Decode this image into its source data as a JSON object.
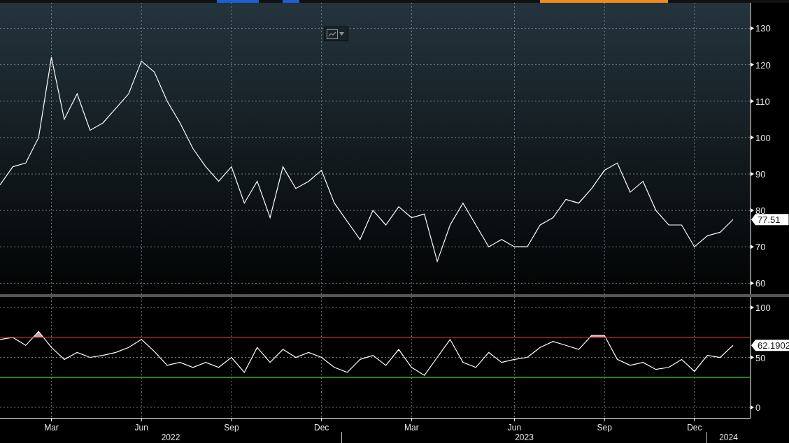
{
  "toolbar_edges": [
    {
      "color": "#1d5fd0"
    },
    {
      "color": "#1d5fd0"
    },
    {
      "color": "#f08a1c"
    }
  ],
  "chart_type_button": {
    "kind": "line"
  },
  "price_panel": {
    "chart_data": {
      "type": "line",
      "grid": true,
      "ylim": [
        57,
        137
      ],
      "yticks": [
        60,
        70,
        80,
        90,
        100,
        110,
        120,
        130
      ],
      "categories": [
        null,
        null,
        null,
        null,
        null,
        null,
        null,
        null,
        null,
        null,
        null,
        null,
        null,
        null,
        null,
        null,
        null,
        null,
        null,
        null,
        null,
        null,
        null,
        null,
        null,
        null,
        null,
        null,
        null,
        null,
        null,
        null,
        null,
        null,
        null,
        null,
        null,
        null,
        null,
        null,
        null,
        null,
        null,
        null,
        null,
        null,
        null,
        null,
        null,
        null,
        null,
        null,
        null,
        null,
        null,
        null,
        null,
        null
      ],
      "series": [
        {
          "color": "#ffffff",
          "values": [
            87,
            92,
            93,
            100,
            122,
            105,
            112,
            102,
            104,
            108,
            112,
            121,
            118,
            110,
            104,
            97,
            92,
            88,
            92,
            82,
            88,
            78,
            92,
            86,
            88,
            91,
            82,
            77,
            72,
            80,
            76,
            81,
            78,
            79,
            66,
            76,
            82,
            76,
            70,
            72,
            70,
            70,
            76,
            78,
            83,
            82,
            86,
            91,
            93,
            85,
            88,
            80,
            76,
            76,
            70,
            73,
            74,
            77.5
          ]
        }
      ],
      "annotations": [
        "77.51"
      ]
    }
  },
  "rsi_panel": {
    "chart_data": {
      "type": "line",
      "grid": true,
      "ylim": [
        -10.5,
        110.5
      ],
      "yticks": [
        0,
        50,
        100
      ],
      "categories": [
        null,
        null,
        null,
        null,
        "Mar",
        null,
        null,
        null,
        null,
        null,
        null,
        "Jun",
        null,
        null,
        null,
        null,
        null,
        null,
        "Sep",
        null,
        null,
        null,
        null,
        null,
        null,
        "Dec",
        null,
        null,
        null,
        null,
        null,
        null,
        "Mar",
        null,
        null,
        null,
        null,
        null,
        null,
        null,
        "Jun",
        null,
        null,
        null,
        null,
        null,
        null,
        "Sep",
        null,
        null,
        null,
        null,
        null,
        null,
        "Dec",
        null,
        null,
        null
      ],
      "series": [
        {
          "color": "#ffffff",
          "values": [
            68,
            70,
            62,
            76,
            60,
            48,
            55,
            50,
            52,
            55,
            60,
            68,
            56,
            42,
            45,
            40,
            45,
            40,
            50,
            35,
            60,
            45,
            58,
            50,
            55,
            50,
            40,
            35,
            48,
            52,
            42,
            58,
            40,
            32,
            50,
            68,
            45,
            40,
            55,
            45,
            48,
            50,
            60,
            66,
            62,
            58,
            72,
            72,
            48,
            42,
            45,
            38,
            40,
            48,
            36,
            52,
            50,
            62
          ]
        }
      ],
      "ref_lines": [
        {
          "axis": "y",
          "value": 70,
          "color": "#c8282d"
        },
        {
          "axis": "y",
          "value": 30,
          "color": "#2fc22f"
        }
      ],
      "annotations": [
        "62.1902"
      ]
    },
    "years": [
      {
        "label": "2022"
      },
      {
        "label": "2023"
      },
      {
        "label": "2024"
      }
    ]
  }
}
